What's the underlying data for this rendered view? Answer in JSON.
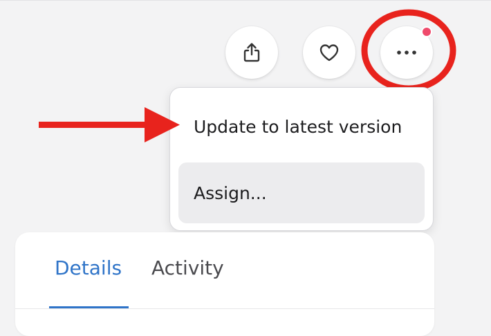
{
  "toolbar": {
    "share_icon": "share-icon",
    "favorite_icon": "heart-icon",
    "more_icon": "more-horizontal-icon",
    "notification": "dot"
  },
  "menu": {
    "items": [
      {
        "label": "Update to latest version"
      },
      {
        "label": "Assign..."
      }
    ]
  },
  "tabs": [
    {
      "label": "Details",
      "active": true
    },
    {
      "label": "Activity",
      "active": false
    }
  ],
  "colors": {
    "accent": "#2f74c8",
    "annotation_red": "#e8231d",
    "notification_dot": "#ef4a6b",
    "background": "#f3f3f4"
  }
}
